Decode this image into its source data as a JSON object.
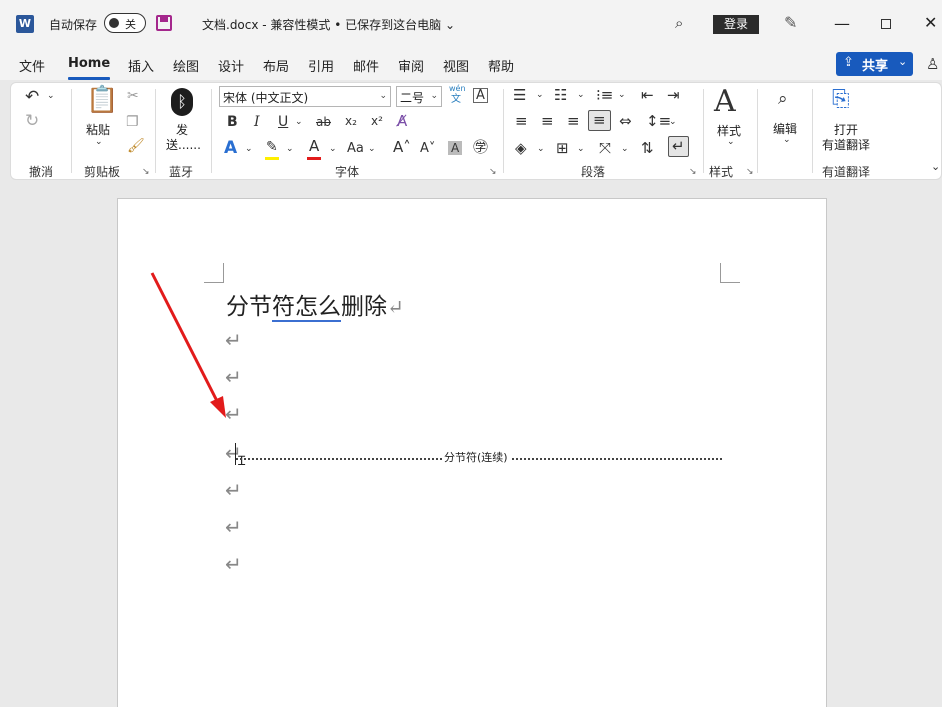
{
  "titlebar": {
    "autosave_label": "自动保存",
    "toggle_state": "关",
    "doc_title": "文档.docx  -  兼容性模式 • 已保存到这台电脑  ⌄",
    "login": "登录",
    "min": "—",
    "close": "✕"
  },
  "tabs": [
    "文件",
    "Home",
    "插入",
    "绘图",
    "设计",
    "布局",
    "引用",
    "邮件",
    "审阅",
    "视图",
    "帮助"
  ],
  "share": "共享",
  "ribbon": {
    "undo_label": "撤消",
    "paste": "粘贴",
    "clipboard_label": "剪贴板",
    "bt_send": "发",
    "bt_send2": "送......",
    "bluetooth_label": "蓝牙",
    "font_name": "宋体 (中文正文)",
    "font_size": "二号",
    "wen": "wén",
    "wen2": "文",
    "font_label": "字体",
    "bold": "B",
    "italic": "I",
    "underline": "U",
    "strike": "ab",
    "sub": "x₂",
    "sup": "x²",
    "aa": "Aa",
    "paragraph_label": "段落",
    "styles": "样式",
    "styles_label": "样式",
    "edit": "编辑",
    "open": "打开",
    "youdao": "有道翻译",
    "youdao_label": "有道翻译"
  },
  "document": {
    "heading_a": "分节",
    "heading_b": "符怎么",
    "heading_c": "删除",
    "return_mark": "↵",
    "section_break_label": "分节符(连续)"
  },
  "colors": {
    "accent": "#185abd",
    "annotation_arrow": "#e21b1b"
  }
}
